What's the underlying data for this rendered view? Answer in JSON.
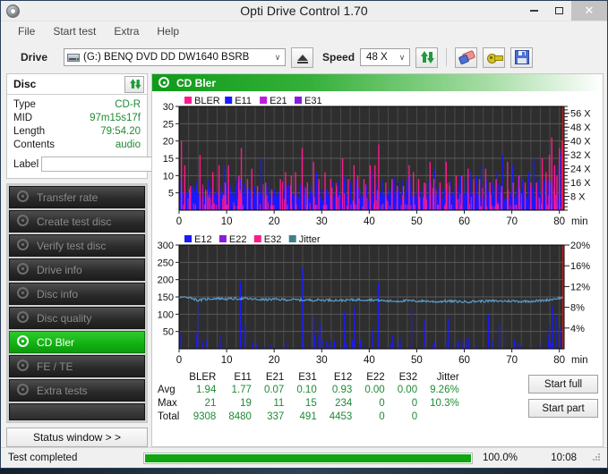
{
  "window": {
    "title": "Opti Drive Control 1.70",
    "icon": "disc-icon",
    "minimize_label": "–",
    "maximize_label": "□",
    "close_label": "✕"
  },
  "menu": {
    "items": [
      "File",
      "Start test",
      "Extra",
      "Help"
    ]
  },
  "toolbar": {
    "drive_label": "Drive",
    "drive_value": "(G:)   BENQ DVD DD DW1640 BSRB",
    "drive_arrow": "∨",
    "eject_name": "eject-button",
    "speed_label": "Speed",
    "speed_value": "48 X",
    "speed_arrow": "∨",
    "refresh_name": "refresh-drive-button",
    "erase_name": "erase-disc-button",
    "plugin_name": "plugin-button",
    "save_name": "save-button"
  },
  "disc_panel": {
    "title": "Disc",
    "refresh_name": "refresh-disc-button",
    "rows": [
      {
        "key": "Type",
        "value": "CD-R"
      },
      {
        "key": "MID",
        "value": "97m15s17f"
      },
      {
        "key": "Length",
        "value": "79:54.20"
      },
      {
        "key": "Contents",
        "value": "audio"
      }
    ],
    "label_key": "Label",
    "label_value": "",
    "label_placeholder": ""
  },
  "nav": {
    "items": [
      {
        "label": "Transfer rate",
        "active": false
      },
      {
        "label": "Create test disc",
        "active": false
      },
      {
        "label": "Verify test disc",
        "active": false
      },
      {
        "label": "Drive info",
        "active": false
      },
      {
        "label": "Disc info",
        "active": false
      },
      {
        "label": "Disc quality",
        "active": false
      },
      {
        "label": "CD Bler",
        "active": true
      },
      {
        "label": "FE / TE",
        "active": false
      },
      {
        "label": "Extra tests",
        "active": false
      }
    ],
    "status_window_label": "Status window > >"
  },
  "chart_panel": {
    "header_title": "CD Bler",
    "start_full_label": "Start full",
    "start_part_label": "Start part"
  },
  "chart_data": [
    {
      "type": "line",
      "title": "CD Bler",
      "chart_id": "bler-chart",
      "xlabel": "min",
      "ylabel": "",
      "xlim": [
        0,
        81
      ],
      "ylim": [
        0,
        30
      ],
      "xticks": [
        0,
        10,
        20,
        30,
        40,
        50,
        60,
        70,
        80
      ],
      "xtick_labels": [
        "0",
        "10",
        "20",
        "30",
        "40",
        "50",
        "60",
        "70",
        "80"
      ],
      "yticks": [
        5,
        10,
        15,
        20,
        25,
        30
      ],
      "ytick_labels": [
        "5",
        "10",
        "15",
        "20",
        "25",
        "30"
      ],
      "y2label": "",
      "y2lim": [
        0,
        60
      ],
      "y2ticks": [
        8,
        16,
        24,
        32,
        40,
        48,
        56
      ],
      "y2tick_labels": [
        "8 X",
        "16 X",
        "24 X",
        "32 X",
        "40 X",
        "48 X",
        "56 X"
      ],
      "grid": true,
      "plot_bg": "#2e2e2e",
      "legend_position": "top-left",
      "legend": [
        {
          "name": "BLER",
          "color": "#ff1a8c"
        },
        {
          "name": "E11",
          "color": "#1a1aff"
        },
        {
          "name": "E21",
          "color": "#c41ae0"
        },
        {
          "name": "E31",
          "color": "#8a1ae0"
        }
      ],
      "series": [
        {
          "name": "BLER",
          "color": "#ff1a8c",
          "x": [
            0.5,
            1.2,
            2.4,
            4.4,
            5.6,
            7.1,
            8.4,
            9.7,
            10.4,
            12.6,
            13.1,
            14.4,
            15.3,
            16.5,
            18.2,
            19.5,
            21.3,
            22.4,
            23.6,
            24.5,
            25.9,
            27.0,
            28.3,
            29.4,
            30.7,
            31.9,
            33.1,
            34.4,
            35.6,
            36.8,
            37.6,
            38.9,
            40.2,
            41.2,
            42.0,
            43.5,
            44.8,
            45.9,
            47.2,
            48.4,
            49.3,
            50.4,
            51.6,
            52.8,
            53.6,
            54.9,
            56.2,
            56.9,
            58.3,
            59.5,
            60.8,
            62.0,
            63.2,
            64.5,
            65.4,
            66.7,
            67.9,
            69.1,
            70.3,
            71.5,
            72.8,
            74.0,
            75.2,
            76.4,
            77.2,
            77.9,
            78.4,
            79.0,
            79.5,
            80.0,
            80.6
          ],
          "y": [
            20,
            13,
            7,
            16,
            6,
            11,
            13,
            8,
            13,
            10,
            18,
            9,
            12,
            7,
            8,
            6,
            9,
            11,
            10,
            11,
            18,
            8,
            14,
            9,
            11,
            9,
            7,
            15,
            9,
            13,
            10,
            9,
            13,
            13,
            19,
            8,
            9,
            7,
            7,
            13,
            11,
            9,
            8,
            14,
            9,
            8,
            14,
            7,
            10,
            10,
            12,
            9,
            9,
            12,
            8,
            9,
            7,
            14,
            8,
            10,
            8,
            8,
            8,
            15,
            11,
            16,
            21,
            13,
            10,
            18,
            20
          ]
        },
        {
          "name": "E11",
          "color": "#1a1aff",
          "x": [
            0.4,
            1.5,
            2.8,
            3.9,
            5.0,
            6.1,
            7.2,
            8.3,
            9.4,
            10.1,
            11.2,
            12.3,
            12.9,
            14.0,
            15.1,
            16.2,
            17.3,
            18.4,
            19.0,
            20.1,
            21.2,
            22.3,
            23.4,
            24.5,
            25.6,
            26.7,
            27.8,
            28.9,
            30.0,
            31.1,
            32.2,
            33.3,
            34.4,
            35.0,
            36.1,
            37.2,
            38.3,
            39.4,
            40.5,
            41.6,
            42.7,
            43.8,
            44.9,
            46.0,
            47.1,
            48.2,
            49.3,
            50.4,
            51.5,
            52.6,
            53.7,
            54.8,
            55.9,
            57.0,
            58.1,
            59.2,
            60.3,
            61.4,
            62.5,
            63.6,
            64.7,
            65.8,
            66.9,
            68.0,
            69.1,
            70.2,
            71.3,
            72.4,
            73.5,
            74.6,
            75.7,
            76.8,
            77.5,
            78.2,
            78.9,
            79.6,
            80.2,
            80.7
          ],
          "y": [
            9,
            5,
            4,
            5,
            4,
            9,
            6,
            5,
            13,
            8,
            5,
            10,
            9,
            5,
            6,
            5,
            15,
            7,
            6,
            6,
            5,
            8,
            6,
            9,
            7,
            6,
            7,
            11,
            6,
            6,
            8,
            7,
            12,
            10,
            8,
            9,
            6,
            7,
            11,
            6,
            9,
            5,
            9,
            8,
            9,
            10,
            6,
            7,
            7,
            8,
            12,
            6,
            6,
            9,
            7,
            10,
            9,
            11,
            10,
            13,
            9,
            8,
            11,
            16,
            12,
            13,
            10,
            9,
            11,
            15,
            9,
            9,
            9,
            8,
            11,
            13,
            17,
            19
          ]
        }
      ],
      "notes": "Dense BLER/E11 error spikes across full 80-minute disc; blue E11 forms solid band near baseline ~3-5; red write-speed trace drawn at right edge"
    },
    {
      "type": "line",
      "title": "",
      "chart_id": "e12-jitter-chart",
      "xlabel": "min",
      "ylabel": "",
      "xlim": [
        0,
        81
      ],
      "ylim": [
        0,
        300
      ],
      "xticks": [
        0,
        10,
        20,
        30,
        40,
        50,
        60,
        70,
        80
      ],
      "xtick_labels": [
        "0",
        "10",
        "20",
        "30",
        "40",
        "50",
        "60",
        "70",
        "80"
      ],
      "yticks": [
        50,
        100,
        150,
        200,
        250,
        300
      ],
      "ytick_labels": [
        "50",
        "100",
        "150",
        "200",
        "250",
        "300"
      ],
      "y2lim": [
        0,
        20
      ],
      "y2ticks": [
        4,
        8,
        12,
        16,
        20
      ],
      "y2tick_labels": [
        "4%",
        "8%",
        "12%",
        "16%",
        "20%"
      ],
      "grid": true,
      "plot_bg": "#2e2e2e",
      "legend_position": "top-left",
      "legend": [
        {
          "name": "E12",
          "color": "#1a1aff"
        },
        {
          "name": "E22",
          "color": "#8a1ae0"
        },
        {
          "name": "E32",
          "color": "#ff1a8c"
        },
        {
          "name": "Jitter",
          "color": "#3f7f8c"
        }
      ],
      "series": [
        {
          "name": "E12",
          "color": "#1a1aff",
          "x": [
            0.4,
            3.9,
            8.6,
            12.9,
            13.9,
            16.3,
            19.4,
            25.9,
            28.3,
            29.6,
            32.7,
            34.8,
            36.9,
            38.0,
            40.7,
            41.9,
            44.6,
            46.6,
            48.9,
            51.6,
            53.7,
            56.6,
            59.8,
            62.4,
            65.1,
            67.4,
            70.5,
            72.0,
            77.9,
            78.6,
            79.3,
            80.1
          ],
          "y": [
            46,
            132,
            36,
            196,
            71,
            12,
            15,
            234,
            91,
            73,
            22,
            106,
            122,
            17,
            55,
            191,
            14,
            8,
            120,
            82,
            22,
            88,
            29,
            12,
            100,
            74,
            26,
            10,
            72,
            124,
            96,
            60
          ]
        },
        {
          "name": "Jitter",
          "color": "#5c9ecf",
          "x": [
            0,
            2,
            4,
            6,
            8,
            10,
            12,
            14,
            16,
            18,
            20,
            22,
            24,
            26,
            28,
            30,
            32,
            34,
            36,
            38,
            40,
            42,
            44,
            46,
            48,
            50,
            52,
            54,
            56,
            58,
            60,
            62,
            64,
            66,
            68,
            70,
            72,
            74,
            76,
            78,
            80
          ],
          "y": [
            148,
            150,
            140,
            144,
            146,
            144,
            145,
            145,
            143,
            142,
            143,
            142,
            142,
            141,
            141,
            141,
            141,
            140,
            141,
            142,
            142,
            140,
            138,
            138,
            139,
            138,
            138,
            136,
            138,
            137,
            136,
            137,
            138,
            138,
            138,
            138,
            137,
            138,
            139,
            142,
            147
          ]
        }
      ],
      "notes": "Jitter trace (light blue) flat near 140-150 corresponding to ~9%; E12 blue spikes sparse; red speed line at right edge"
    }
  ],
  "stats": {
    "columns": [
      "BLER",
      "E11",
      "E21",
      "E31",
      "E12",
      "E22",
      "E32",
      "Jitter"
    ],
    "rows": [
      {
        "label": "Avg",
        "values": [
          "1.94",
          "1.77",
          "0.07",
          "0.10",
          "0.93",
          "0.00",
          "0.00",
          "9.26%"
        ]
      },
      {
        "label": "Max",
        "values": [
          "21",
          "19",
          "11",
          "15",
          "234",
          "0",
          "0",
          "10.3%"
        ]
      },
      {
        "label": "Total",
        "values": [
          "9308",
          "8480",
          "337",
          "491",
          "4453",
          "0",
          "0",
          ""
        ]
      }
    ]
  },
  "statusbar": {
    "message": "Test completed",
    "progress_percent": 100,
    "progress_text": "100.0%",
    "clock": "10:08"
  },
  "colors": {
    "accent_green": "#12a512",
    "value_green": "#1f8a35",
    "plot_bg": "#2e2e2e",
    "bler_pink": "#ff1a8c",
    "e11_blue": "#1a1aff",
    "jitter_blue": "#5c9ecf",
    "speed_red": "#e01b1b"
  }
}
